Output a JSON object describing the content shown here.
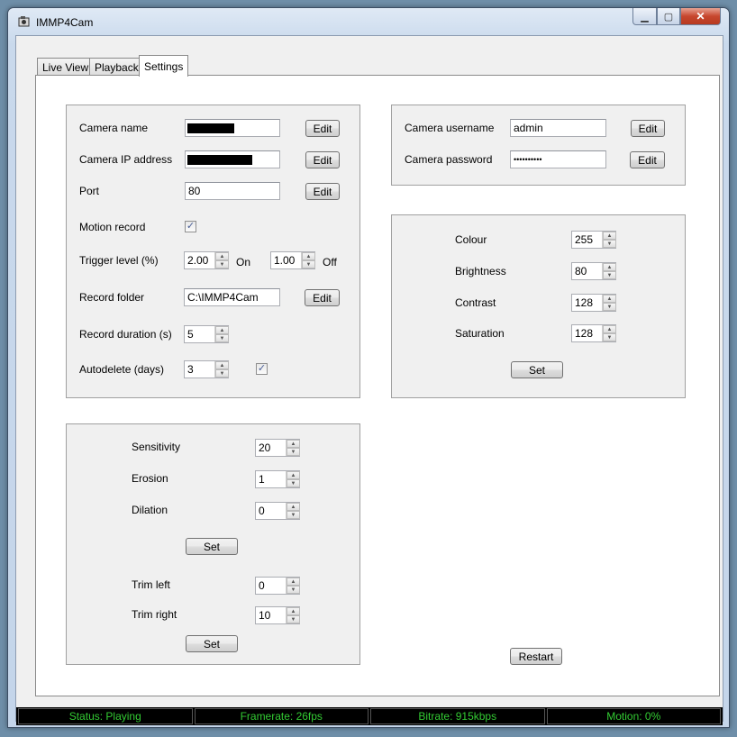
{
  "window": {
    "title": "IMMP4Cam",
    "minimize": "▁",
    "maximize": "▢",
    "close": "✕"
  },
  "tabs": [
    "Live View",
    "Playback",
    "Settings"
  ],
  "camera": {
    "name_label": "Camera name",
    "ip_label": "Camera IP address",
    "port_label": "Port",
    "port_value": "80",
    "motion_record_label": "Motion record",
    "trigger_label": "Trigger level (%)",
    "trigger_on_value": "2.00",
    "on_label": "On",
    "trigger_off_value": "1.00",
    "off_label": "Off",
    "record_folder_label": "Record folder",
    "record_folder_value": "C:\\IMMP4Cam",
    "record_duration_label": "Record duration (s)",
    "record_duration_value": "5",
    "autodelete_label": "Autodelete (days)",
    "autodelete_value": "3",
    "edit": "Edit"
  },
  "auth": {
    "username_label": "Camera username",
    "username_value": "admin",
    "password_label": "Camera password",
    "password_value": "••••••••••",
    "edit": "Edit"
  },
  "image": {
    "colour_label": "Colour",
    "colour_value": "255",
    "brightness_label": "Brightness",
    "brightness_value": "80",
    "contrast_label": "Contrast",
    "contrast_value": "128",
    "saturation_label": "Saturation",
    "saturation_value": "128",
    "set": "Set"
  },
  "motion": {
    "sensitivity_label": "Sensitivity",
    "sensitivity_value": "20",
    "erosion_label": "Erosion",
    "erosion_value": "1",
    "dilation_label": "Dilation",
    "dilation_value": "0",
    "set": "Set",
    "trim_left_label": "Trim left",
    "trim_left_value": "0",
    "trim_right_label": "Trim right",
    "trim_right_value": "10",
    "set2": "Set"
  },
  "restart": "Restart",
  "status": {
    "status": "Status: Playing",
    "framerate": "Framerate: 26fps",
    "bitrate": "Bitrate: 915kbps",
    "motion": "Motion: 0%"
  },
  "icons": {
    "app": "camera-app-icon",
    "check": "checkmark-icon",
    "up": "spin-up-icon",
    "down": "spin-down-icon"
  },
  "colors": {
    "status_text": "#33cc33",
    "status_bg": "#000000",
    "close_button": "#c7472e"
  }
}
